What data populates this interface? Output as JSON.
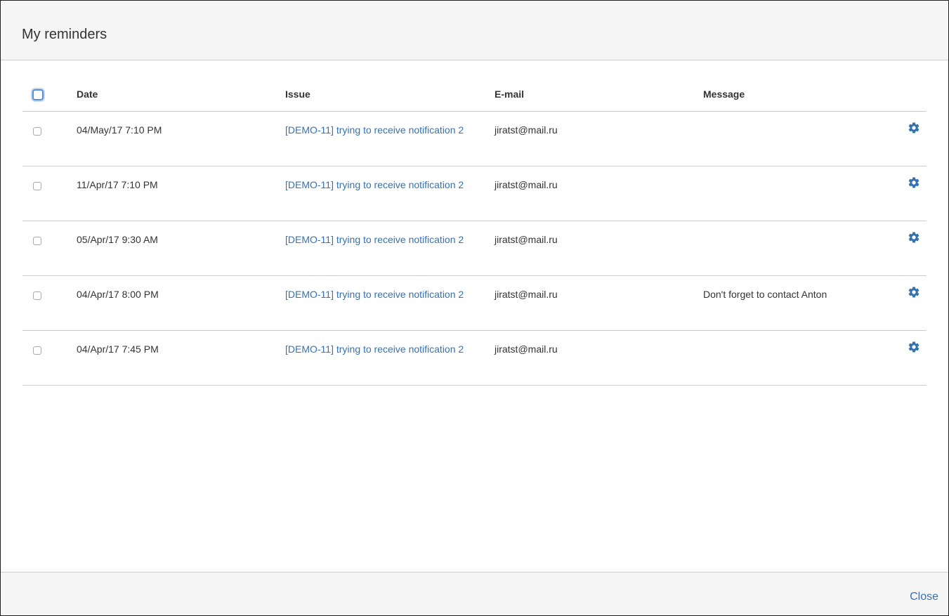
{
  "dialog": {
    "title": "My reminders",
    "close_label": "Close"
  },
  "table": {
    "headers": {
      "date": "Date",
      "issue": "Issue",
      "email": "E-mail",
      "message": "Message"
    },
    "rows": [
      {
        "date": "04/May/17 7:10 PM",
        "issue": "[DEMO-11] trying to receive notification 2",
        "email": "jiratst@mail.ru",
        "message": "",
        "checked": false
      },
      {
        "date": "11/Apr/17 7:10 PM",
        "issue": "[DEMO-11] trying to receive notification 2",
        "email": "jiratst@mail.ru",
        "message": "",
        "checked": false
      },
      {
        "date": "05/Apr/17 9:30 AM",
        "issue": "[DEMO-11] trying to receive notification 2",
        "email": "jiratst@mail.ru",
        "message": "",
        "checked": false
      },
      {
        "date": "04/Apr/17 8:00 PM",
        "issue": "[DEMO-11] trying to receive notification 2",
        "email": "jiratst@mail.ru",
        "message": "Don't forget to contact Anton",
        "checked": false
      },
      {
        "date": "04/Apr/17 7:45 PM",
        "issue": "[DEMO-11] trying to receive notification 2",
        "email": "jiratst@mail.ru",
        "message": "",
        "checked": false
      }
    ],
    "action_icon": "gear-icon"
  },
  "colors": {
    "link": "#3572b0",
    "header_bg": "#f5f5f5",
    "border": "#cccccc",
    "text": "#333333"
  }
}
